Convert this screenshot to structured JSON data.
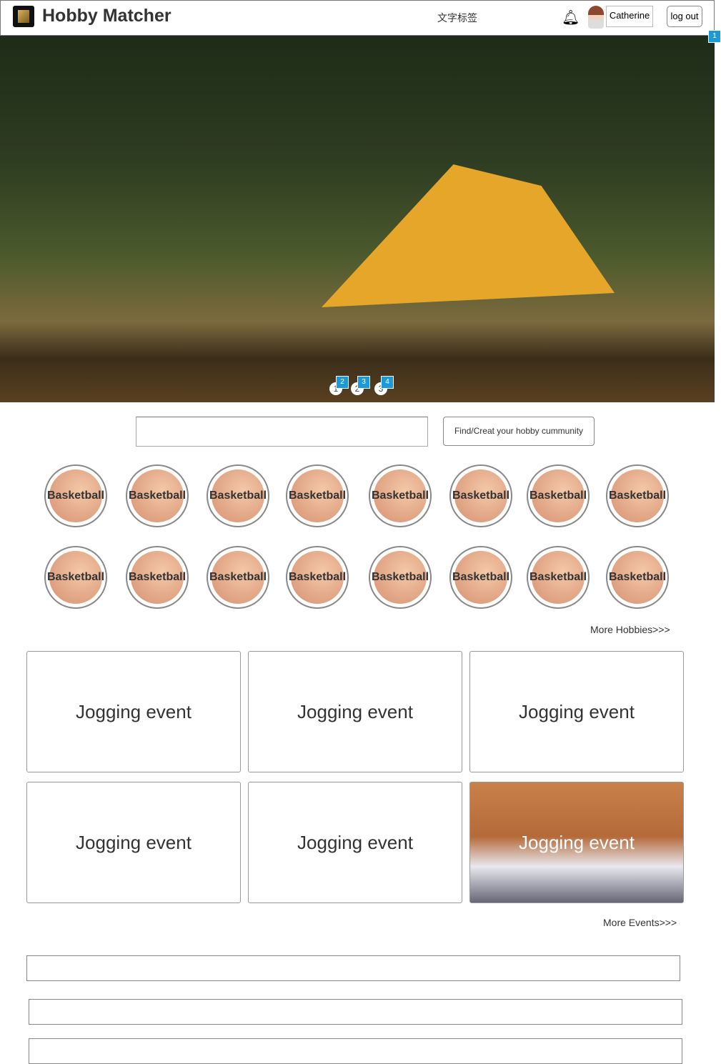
{
  "header": {
    "title": "Hobby Matcher",
    "tag": "文字标签",
    "user": "Catherine",
    "logout": "log out"
  },
  "hero": {
    "badges": [
      "1",
      "2",
      "3",
      "4"
    ],
    "dots": [
      "1",
      "2",
      "3"
    ]
  },
  "search": {
    "value": "",
    "button": "Find/Creat  your hobby cummunity"
  },
  "hobbies": [
    "Basketball",
    "Basketball",
    "Basketball",
    "Basketball",
    "Basketball",
    "Basketball",
    "Basketball",
    "Basketball",
    "Basketball",
    "Basketball",
    "Basketball",
    "Basketball",
    "Basketball",
    "Basketball",
    "Basketball",
    "Basketball"
  ],
  "more_hobbies": "More Hobbies>>>",
  "events": [
    "Jogging event",
    "Jogging event",
    "Jogging event",
    "Jogging event",
    "Jogging event",
    "Jogging event"
  ],
  "more_events": "More Events>>>"
}
